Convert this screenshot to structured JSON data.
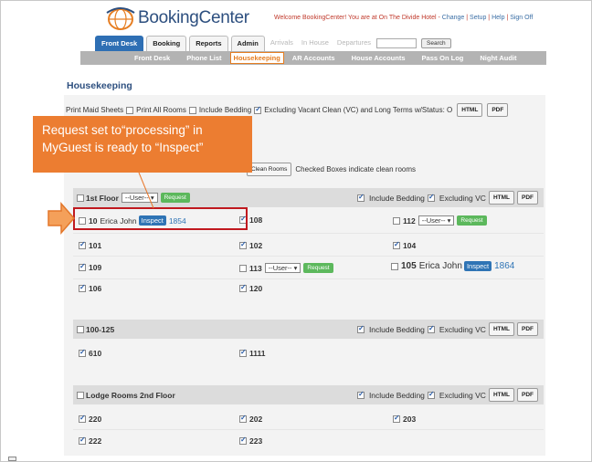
{
  "header": {
    "logo_text": "BookingCenter",
    "welcome_text": "Welcome BookingCenter! You are at On The Divide Hotel -",
    "links": [
      "Change",
      "Setup",
      "Help",
      "Sign Off"
    ]
  },
  "tabs": [
    "Front Desk",
    "Booking",
    "Reports",
    "Admin"
  ],
  "faded_tabs": [
    "Arrivals",
    "In House",
    "Departures"
  ],
  "search_button": "Search",
  "subnav": [
    "Front Desk",
    "Phone List",
    "Housekeeping",
    "AR Accounts",
    "House Accounts",
    "Pass On Log",
    "Night Audit"
  ],
  "page_title": "Housekeeping",
  "topline": {
    "text_a": "Print Maid Sheets",
    "text_b": "Print All Rooms",
    "text_c": "Include Bedding",
    "text_d": "Excluding Vacant Clean (VC) and Long Terms w/Status: O",
    "html_btn": "HTML",
    "pdf_btn": "PDF"
  },
  "clean_row": {
    "button": "Clean Rooms",
    "text": "Checked Boxes indicate clean rooms"
  },
  "callout": {
    "line1": "Request  set to“processing” in",
    "line2": "MyGuest is ready to “Inspect”"
  },
  "sections": [
    {
      "name": "1st Floor",
      "user_select": "--User--",
      "request_btn": "Request",
      "include_bedding": "Include Bedding",
      "excluding_vc": "Excluding VC",
      "html_btn": "HTML",
      "pdf_btn": "PDF"
    },
    {
      "name": "100-125",
      "include_bedding": "Include Bedding",
      "excluding_vc": "Excluding VC",
      "html_btn": "HTML",
      "pdf_btn": "PDF"
    },
    {
      "name": "Lodge Rooms 2nd Floor",
      "include_bedding": "Include Bedding",
      "excluding_vc": "Excluding VC",
      "html_btn": "HTML",
      "pdf_btn": "PDF"
    }
  ],
  "rooms": {
    "r10": {
      "room": "10",
      "guest": "Erica John",
      "btn": "Inspect",
      "num": "1854"
    },
    "r108": "108",
    "r112": {
      "room": "112",
      "select": "--User--",
      "btn": "Request"
    },
    "r101": "101",
    "r102": "102",
    "r104": "104",
    "r109": "109",
    "r113": {
      "room": "113",
      "select": "--User--",
      "btn": "Request"
    },
    "r105": {
      "room": "105",
      "guest": "Erica John",
      "btn": "Inspect",
      "num": "1864"
    },
    "r106": "106",
    "r120": "120",
    "r610": "610",
    "r1111": "1111",
    "r220": "220",
    "r202": "202",
    "r203": "203",
    "r222": "222",
    "r223": "223"
  },
  "colors": {
    "accent": "#2e6fb4",
    "callout": "#ec7d31",
    "highlight": "#c0191f",
    "request_green": "#5cb85c"
  }
}
